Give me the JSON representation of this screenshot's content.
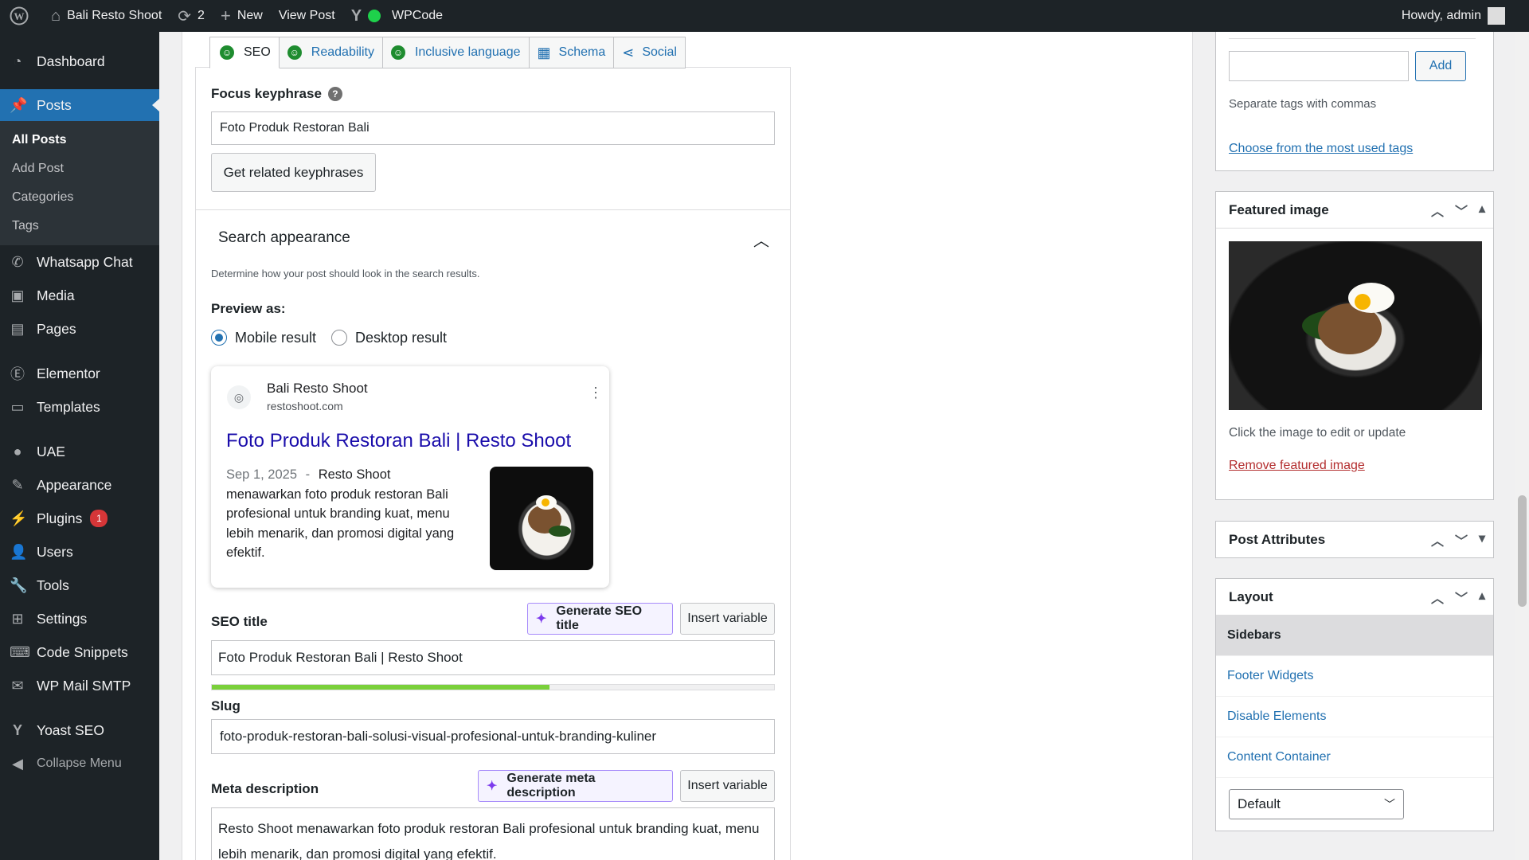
{
  "adminbar": {
    "site_name": "Bali Resto Shoot",
    "updates_count": "2",
    "new_label": "New",
    "view_post": "View Post",
    "wpcode": "WPCode",
    "howdy": "Howdy, admin"
  },
  "sidebar": {
    "dashboard": "Dashboard",
    "posts": "Posts",
    "sub": [
      "All Posts",
      "Add Post",
      "Categories",
      "Tags"
    ],
    "whatsapp": "Whatsapp Chat",
    "media": "Media",
    "pages": "Pages",
    "elementor": "Elementor",
    "templates": "Templates",
    "uae": "UAE",
    "appearance": "Appearance",
    "plugins": "Plugins",
    "plugins_badge": "1",
    "users": "Users",
    "tools": "Tools",
    "settings": "Settings",
    "code_snippets": "Code Snippets",
    "wp_mail_smtp": "WP Mail SMTP",
    "yoast": "Yoast SEO",
    "collapse": "Collapse Menu"
  },
  "tabs": [
    "SEO",
    "Readability",
    "Inclusive language",
    "Schema",
    "Social"
  ],
  "seo": {
    "focus_label": "Focus keyphrase",
    "focus_value": "Foto Produk Restoran Bali",
    "related_btn": "Get related keyphrases",
    "search_appearance": "Search appearance",
    "search_desc": "Determine how your post should look in the search results.",
    "preview_as": "Preview as:",
    "mobile": "Mobile result",
    "desktop": "Desktop result",
    "seo_title_label": "SEO title",
    "gen_title_btn": "Generate SEO title",
    "insert_variable": "Insert variable",
    "seo_title_value": "Foto Produk Restoran Bali | Resto Shoot",
    "title_progress": 0.6,
    "slug_label": "Slug",
    "slug_value": "foto-produk-restoran-bali-solusi-visual-profesional-untuk-branding-kuliner",
    "meta_label": "Meta description",
    "gen_meta_btn": "Generate meta description",
    "meta_value": "Resto Shoot menawarkan foto produk restoran Bali profesional untuk branding kuat, menu lebih menarik, dan promosi digital yang efektif."
  },
  "serp": {
    "site": "Bali Resto Shoot",
    "url": "restoshoot.com",
    "title": "Foto Produk Restoran Bali | Resto Shoot",
    "date": "Sep 1, 2025",
    "dash": "-",
    "author": "Resto Shoot",
    "snippet": "menawarkan foto produk restoran Bali profesional untuk branding kuat, menu lebih menarik, dan promosi digital yang efektif."
  },
  "tags_box": {
    "add_btn": "Add",
    "hint": "Separate tags with commas",
    "choose_link": "Choose from the most used tags"
  },
  "featured": {
    "title": "Featured image",
    "hint": "Click the image to edit or update",
    "remove": "Remove featured image"
  },
  "post_attributes": {
    "title": "Post Attributes"
  },
  "layout": {
    "title": "Layout",
    "rows": [
      "Sidebars",
      "Footer Widgets",
      "Disable Elements",
      "Content Container"
    ],
    "select_value": "Default"
  }
}
